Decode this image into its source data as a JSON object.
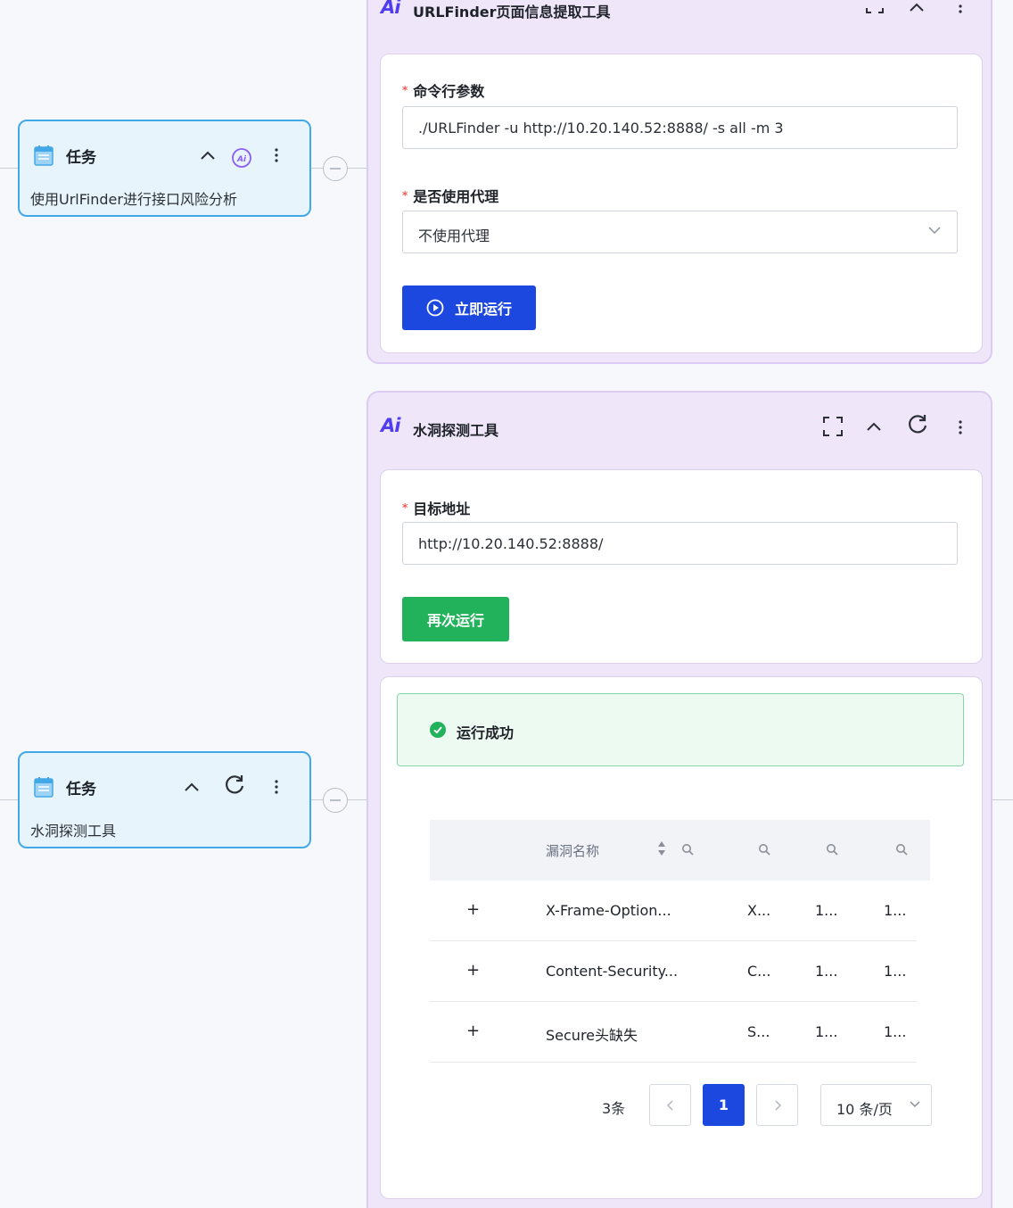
{
  "task_nodes": [
    {
      "title": "任务",
      "description": "使用UrlFinder进行接口风险分析",
      "icons": [
        "document-icon",
        "chevron-up-icon",
        "ai-icon",
        "more-vertical-icon"
      ]
    },
    {
      "title": "任务",
      "description": "水洞探测工具",
      "icons": [
        "document-icon",
        "chevron-up-icon",
        "refresh-icon",
        "more-vertical-icon"
      ]
    }
  ],
  "urlfinder_panel": {
    "logo": "Ai",
    "title": "URLFinder页面信息提取工具",
    "required_marker": "*",
    "fields": [
      {
        "label": "命令行参数",
        "value": "./URLFinder -u http://10.20.140.52:8888/ -s all -m 3"
      },
      {
        "label": "是否使用代理",
        "value": "不使用代理"
      }
    ],
    "run_button": "立即运行",
    "header_icons": [
      "fullscreen-icon",
      "chevron-up-icon",
      "more-vertical-icon"
    ]
  },
  "scanner_panel": {
    "logo": "Ai",
    "title": "水洞探测工具",
    "required_marker": "*",
    "field": {
      "label": "目标地址",
      "value": "http://10.20.140.52:8888/"
    },
    "rerun_button": "再次运行",
    "header_icons": [
      "fullscreen-icon",
      "chevron-up-icon",
      "refresh-icon",
      "more-vertical-icon"
    ],
    "result": {
      "status": "运行成功",
      "table": {
        "name_header": "漏洞名称",
        "rows": [
          {
            "name": "X-Frame-Option...",
            "c2": "X...",
            "c3": "1...",
            "c4": "1..."
          },
          {
            "name": "Content-Security...",
            "c2": "C...",
            "c3": "1...",
            "c4": "1..."
          },
          {
            "name": "Secure头缺失",
            "c2": "S...",
            "c3": "1...",
            "c4": "1..."
          }
        ],
        "expand_symbol": "+"
      },
      "pagination": {
        "total": "3条",
        "current_page": "1",
        "page_size": "10 条/页"
      }
    }
  },
  "colors": {
    "primary": "#1d48e0",
    "success": "#21b25b",
    "panel_bg": "#efe6fa",
    "node_border": "#42a9e6"
  }
}
